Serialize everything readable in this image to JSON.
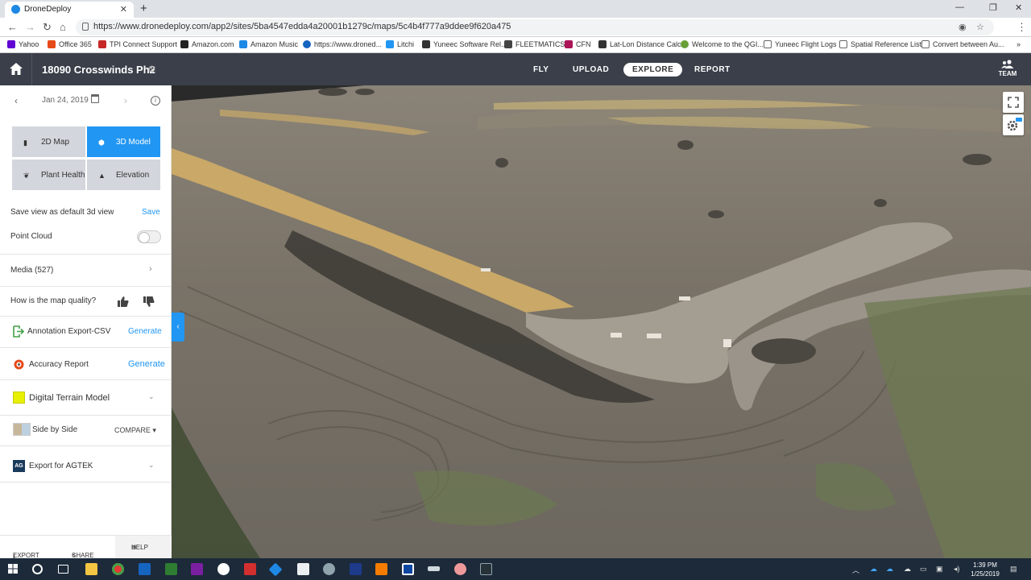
{
  "browser": {
    "tab_title": "DroneDeploy",
    "url": "https://www.dronedeploy.com/app2/sites/5ba4547edda4a20001b1279c/maps/5c4b4f777a9ddee9f620a475",
    "bookmarks": [
      {
        "label": "Yahoo",
        "icon": "yahoo-icon",
        "color": "#6001d2"
      },
      {
        "label": "Office 365",
        "icon": "office-icon",
        "color": "#e64a19"
      },
      {
        "label": "TPI Connect Support",
        "icon": "page-icon",
        "color": "#c62828"
      },
      {
        "label": "Amazon.com",
        "icon": "amazon-icon",
        "color": "#222222"
      },
      {
        "label": "Amazon Music",
        "icon": "amazon-music-icon",
        "color": "#1e88e5"
      },
      {
        "label": "https://www.droned...",
        "icon": "globe-icon",
        "color": "#1565c0"
      },
      {
        "label": "Litchi",
        "icon": "litchi-icon",
        "color": "#2196f3"
      },
      {
        "label": "Yuneec Software Rel...",
        "icon": "yuneec-icon",
        "color": "#333333"
      },
      {
        "label": "FLEETMATICS",
        "icon": "fleet-icon",
        "color": "#444444"
      },
      {
        "label": "CFN",
        "icon": "cfn-icon",
        "color": "#ad1457"
      },
      {
        "label": "Lat-Lon Distance Calc",
        "icon": "calc-icon",
        "color": "#333333"
      },
      {
        "label": "Welcome to the QGI...",
        "icon": "qgis-icon",
        "color": "#689f38"
      },
      {
        "label": "Yuneec Flight Logs",
        "icon": "doc-icon",
        "color": "#666666"
      },
      {
        "label": "Spatial Reference List",
        "icon": "doc-icon",
        "color": "#666666"
      },
      {
        "label": "Convert between Au...",
        "icon": "doc-icon",
        "color": "#666666"
      }
    ]
  },
  "header": {
    "site_name": "18090 Crosswinds Ph2",
    "nav": [
      "FLY",
      "UPLOAD",
      "EXPLORE",
      "REPORT"
    ],
    "active_nav": "EXPLORE",
    "team_label": "TEAM"
  },
  "sidebar": {
    "date": "Jan 24, 2019",
    "views": [
      "2D Map",
      "3D Model",
      "Plant Health",
      "Elevation"
    ],
    "active_view": "3D Model",
    "save_view_label": "Save view as default 3d view",
    "save_label": "Save",
    "point_cloud_label": "Point Cloud",
    "point_cloud_on": false,
    "media_label": "Media (527)",
    "quality_label": "How is the map quality?",
    "annotation_export_label": "Annotation Export-CSV",
    "annotation_export_action": "Generate",
    "accuracy_label": "Accuracy Report",
    "accuracy_action": "Generate",
    "dtm_label": "Digital Terrain Model",
    "side_by_side_label": "Side by Side",
    "compare_label": "COMPARE",
    "agtek_label": "Export for AGTEK",
    "agtek_badge": "AG",
    "footer": {
      "export": "EXPORT",
      "share": "SHARE",
      "help": "HELP"
    }
  },
  "taskbar": {
    "time": "1:39 PM",
    "date": "1/25/2019"
  },
  "colors": {
    "accent": "#2196f3",
    "header": "#3a3f4a"
  }
}
